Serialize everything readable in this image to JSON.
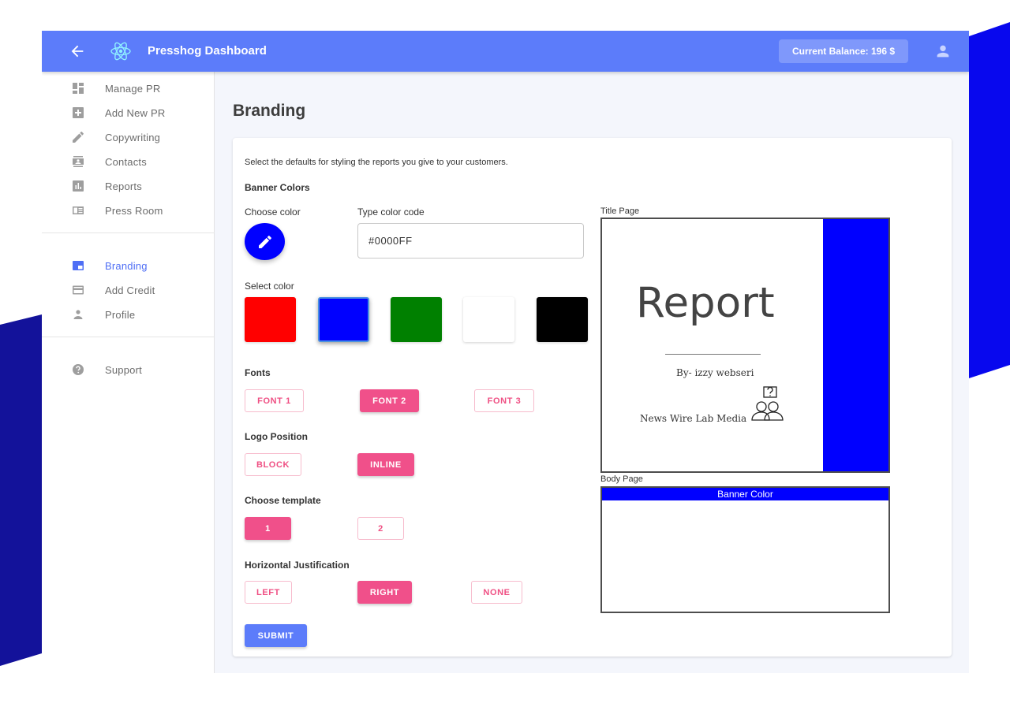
{
  "header": {
    "title": "Presshog Dashboard",
    "balance": "Current Balance: 196 $"
  },
  "sidebar": {
    "items": [
      {
        "label": "Manage PR",
        "icon": "dashboard-icon"
      },
      {
        "label": "Add New PR",
        "icon": "add-box-icon"
      },
      {
        "label": "Copywriting",
        "icon": "pencil-icon"
      },
      {
        "label": "Contacts",
        "icon": "contacts-icon"
      },
      {
        "label": "Reports",
        "icon": "bar-chart-icon"
      },
      {
        "label": "Press Room",
        "icon": "newspaper-icon"
      },
      {
        "label": "Branding",
        "icon": "branding-icon",
        "active": true
      },
      {
        "label": "Add Credit",
        "icon": "credit-card-icon"
      },
      {
        "label": "Profile",
        "icon": "person-icon"
      },
      {
        "label": "Support",
        "icon": "help-icon"
      }
    ]
  },
  "page": {
    "title": "Branding",
    "intro": "Select the defaults for styling the reports you give to your customers.",
    "banner_colors_label": "Banner Colors",
    "choose_color_label": "Choose color",
    "type_color_code_label": "Type color code",
    "color_code_value": "#0000FF",
    "select_color_label": "Select color",
    "swatches": [
      {
        "color": "#ff0000",
        "selected": false
      },
      {
        "color": "#0000ff",
        "selected": true
      },
      {
        "color": "#008000",
        "selected": false
      },
      {
        "color": "#ffffff",
        "selected": false
      },
      {
        "color": "#000000",
        "selected": false
      }
    ],
    "fonts_label": "Fonts",
    "fonts": [
      {
        "label": "FONT 1",
        "selected": false
      },
      {
        "label": "FONT 2",
        "selected": true
      },
      {
        "label": "FONT 3",
        "selected": false
      }
    ],
    "logo_position_label": "Logo Position",
    "logo_positions": [
      {
        "label": "BLOCK",
        "selected": false
      },
      {
        "label": "INLINE",
        "selected": true
      }
    ],
    "template_label": "Choose template",
    "templates": [
      {
        "label": "1",
        "selected": true
      },
      {
        "label": "2",
        "selected": false
      }
    ],
    "justification_label": "Horizontal Justification",
    "justifications": [
      {
        "label": "LEFT",
        "selected": false
      },
      {
        "label": "RIGHT",
        "selected": true
      },
      {
        "label": "NONE",
        "selected": false
      }
    ],
    "submit_label": "SUBMIT"
  },
  "preview": {
    "title_page_label": "Title Page",
    "report_word": "Report",
    "by_line": "By- izzy webseri",
    "company": "News Wire Lab Media",
    "body_page_label": "Body Page",
    "banner_text": "Banner Color",
    "banner_color": "#0000ff"
  },
  "colors": {
    "appbar": "#5c7cfa",
    "accent_pink": "#f0508a",
    "active_nav": "#4e6ef5",
    "decoration": "#0c0c9c"
  }
}
